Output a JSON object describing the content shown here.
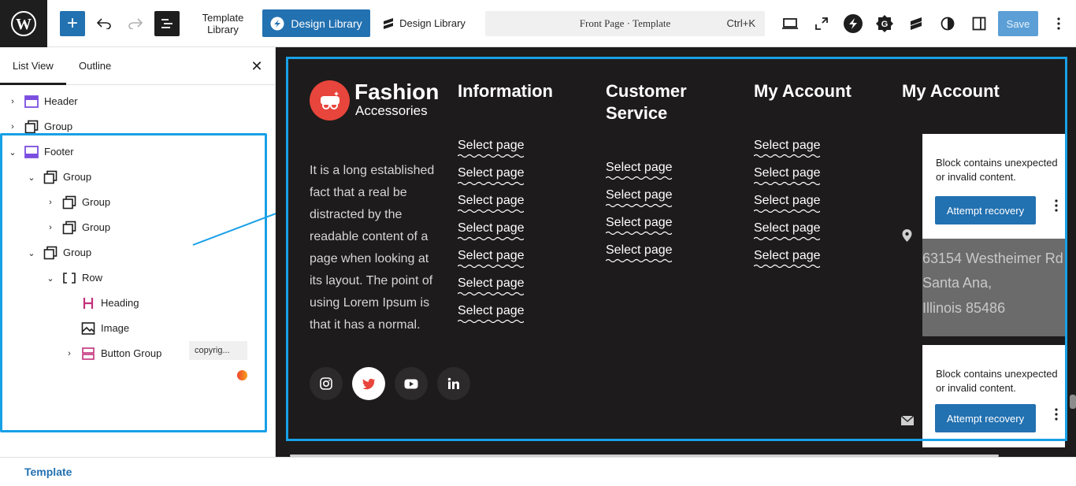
{
  "toolbar": {
    "template_library": "Template\nLibrary",
    "design_library_primary": "Design Library",
    "design_library_secondary": "Design Library",
    "command_title": "Front Page · Template",
    "command_shortcut": "Ctrl+K",
    "save": "Save",
    "accent_color": "#2271b1"
  },
  "sidebar": {
    "tabs": [
      "List View",
      "Outline"
    ],
    "active_tab": "List View",
    "tree": [
      {
        "label": "Header",
        "expanded": false
      },
      {
        "label": "Group",
        "expanded": false
      },
      {
        "label": "Footer",
        "expanded": true
      },
      {
        "label": "Group",
        "expanded": true
      },
      {
        "label": "Group",
        "expanded": false
      },
      {
        "label": "Group",
        "expanded": false
      },
      {
        "label": "Group",
        "expanded": true
      },
      {
        "label": "Row",
        "expanded": true
      },
      {
        "label": "Heading",
        "badge": "copyrig..."
      },
      {
        "label": "Image"
      },
      {
        "label": "Button Group",
        "expanded": false
      }
    ]
  },
  "footer_bar": {
    "label": "Template"
  },
  "site_footer": {
    "brand": {
      "name": "Fashion",
      "tagline": "Accessories"
    },
    "about": "It is a long established fact that a real be distracted by the readable content of a page when looking at its layout. The point of using Lorem Ipsum is that it has a normal.",
    "columns": [
      {
        "title": "Information",
        "links": [
          "Select page",
          "Select page",
          "Select page",
          "Select page",
          "Select page",
          "Select page",
          "Select page"
        ]
      },
      {
        "title": "Customer Service",
        "links": [
          "Select page",
          "Select page",
          "Select page",
          "Select page"
        ]
      },
      {
        "title": "My Account",
        "links": [
          "Select page",
          "Select page",
          "Select page",
          "Select page",
          "Select page"
        ]
      },
      {
        "title": "My Account",
        "links": []
      }
    ],
    "social": [
      "instagram",
      "twitter",
      "youtube",
      "linkedin"
    ],
    "address": [
      "63154 Westheimer Rd",
      "Santa Ana,",
      "Illinois 85486"
    ],
    "recovery": {
      "message": "Block contains unexpected or invalid content.",
      "button": "Attempt recovery"
    },
    "selection_color": "#18a0e6"
  }
}
